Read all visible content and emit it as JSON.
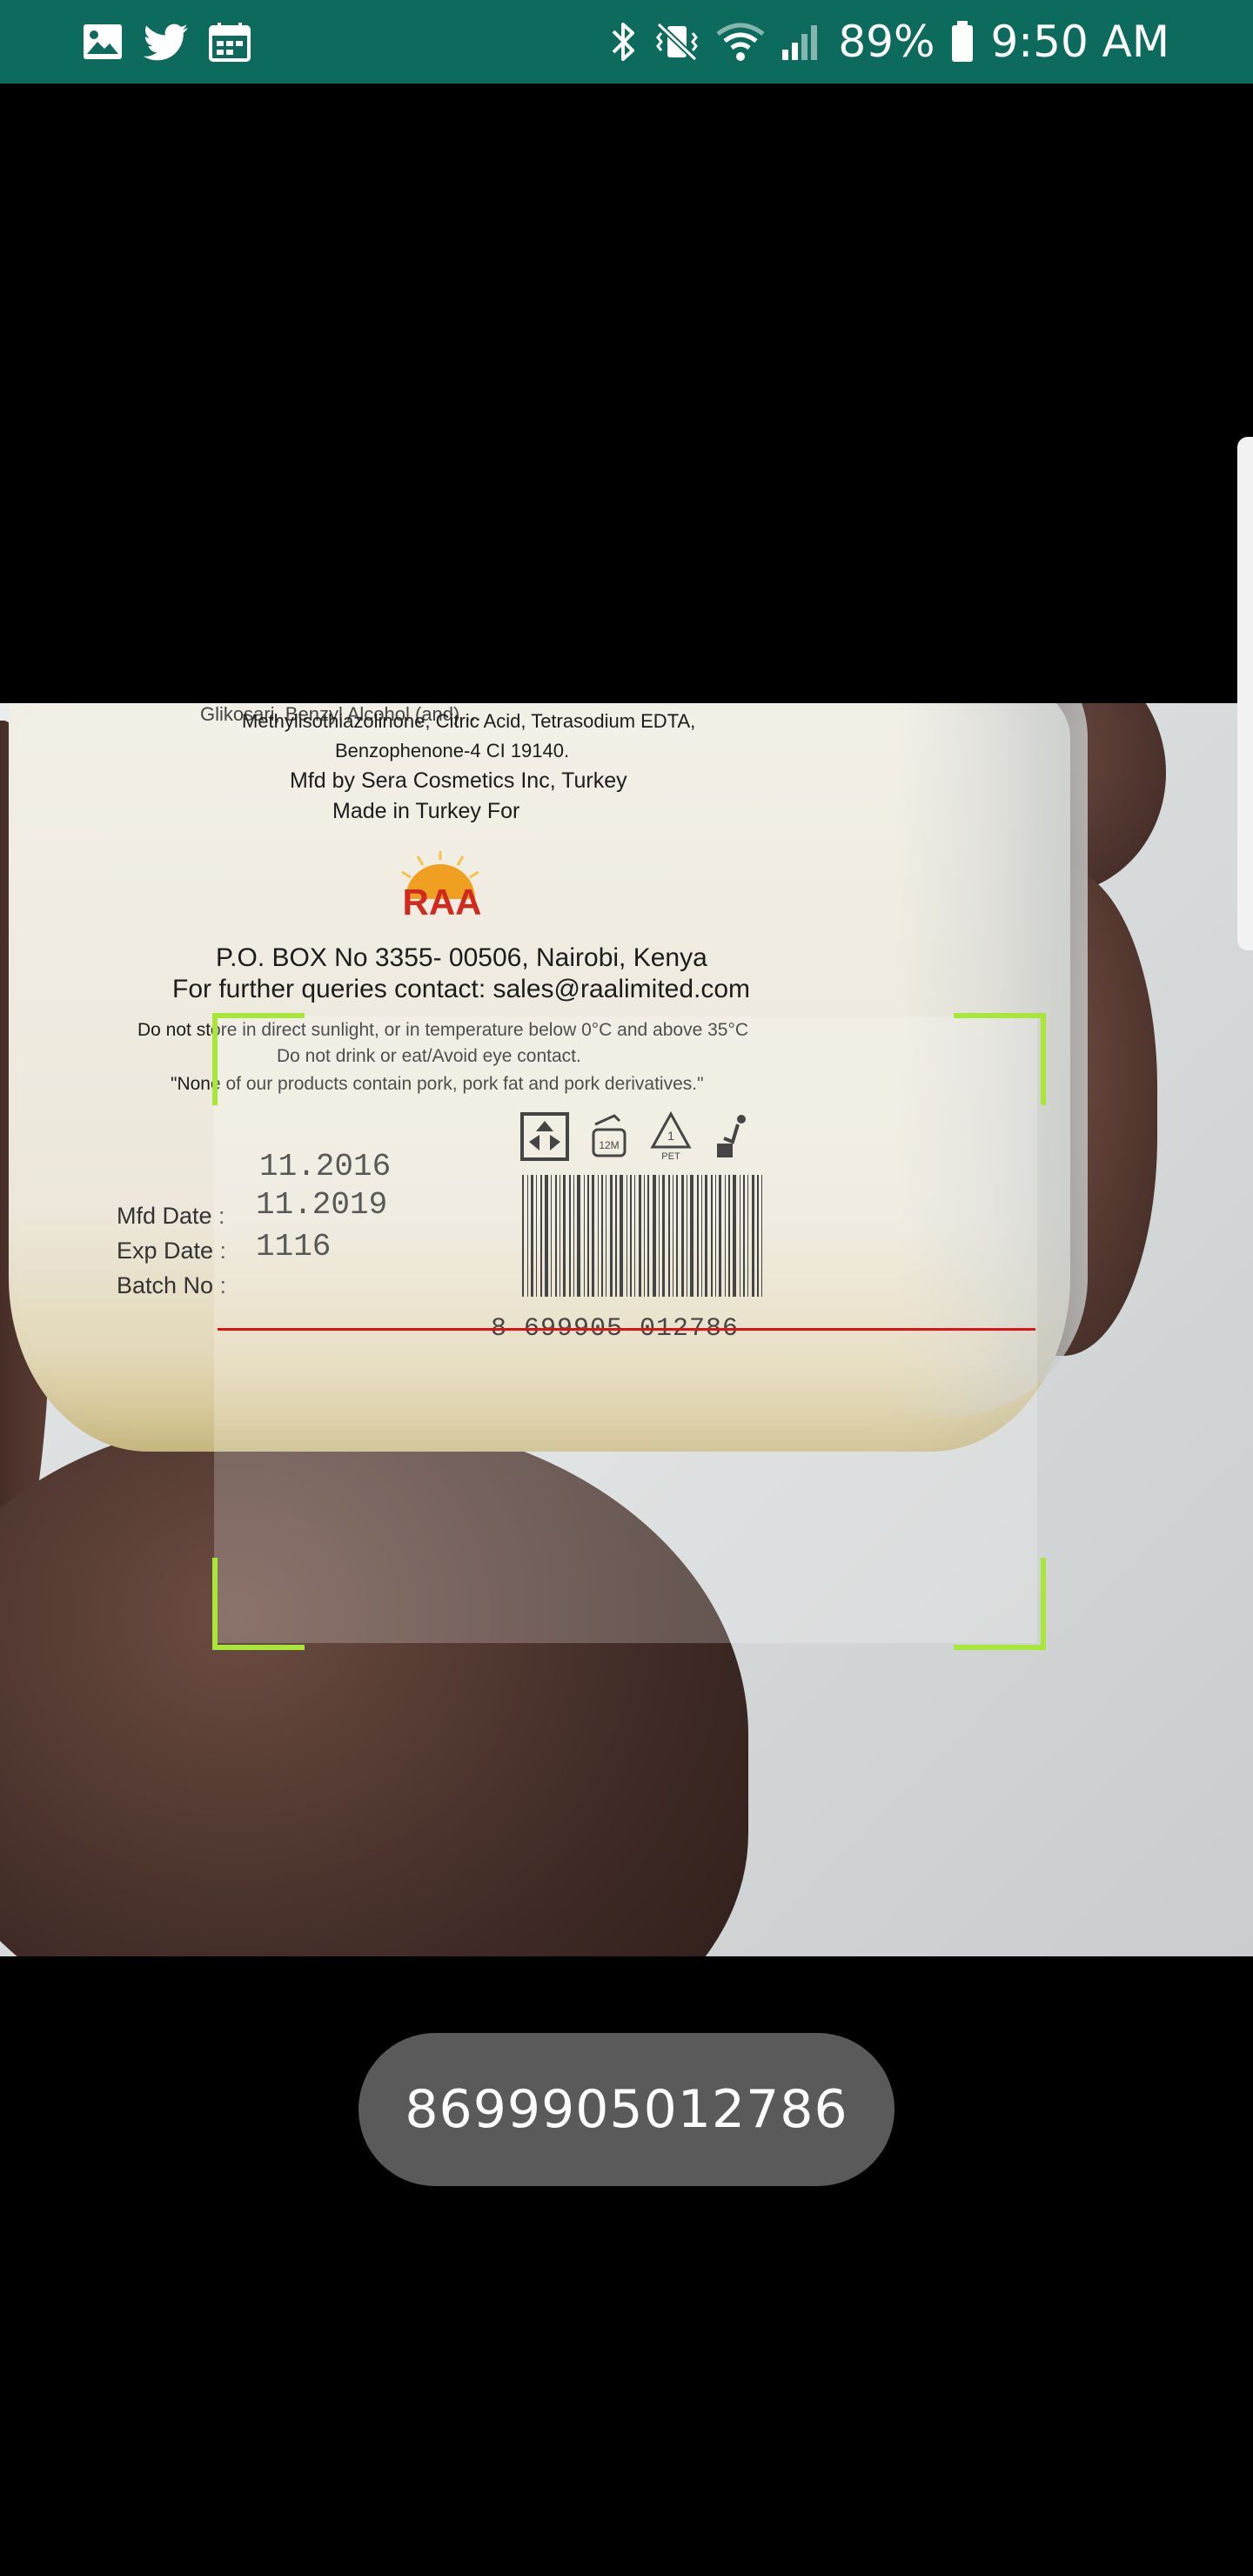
{
  "status_bar": {
    "left_icons": [
      "gallery-icon",
      "twitter-icon",
      "calendar-icon"
    ],
    "right_icons": [
      "bluetooth-icon",
      "vibrate-mute-icon",
      "wifi-icon",
      "signal-icon",
      "battery-icon"
    ],
    "battery_percent": "89%",
    "time": "9:50 AM",
    "background_color": "#0d6b5e"
  },
  "camera_preview": {
    "label_lines": [
      "Glikosari, Benzyl Alcohol (and) ...",
      "Methylisothiazolinone, Citric Acid, Tetrasodium EDTA,",
      "Benzophenone-4  CI 19140.",
      "Mfd by Sera Cosmetics Inc, Turkey",
      "Made in Turkey For"
    ],
    "brand": "RAA",
    "address": "P.O. BOX No 3355- 00506, Nairobi, Kenya",
    "contact": "For further queries contact: sales@raalimited.com",
    "warnings": [
      "Do not store in direct sunlight, or in temperature below 0°C and above 35°C",
      "Do not drink or eat/Avoid eye contact.",
      "\"None of our products contain pork, pork fat and pork derivatives.\""
    ],
    "fields": {
      "mfd_label": "Mfd Date :",
      "exp_label": "Exp Date :",
      "batch_label": "Batch No :",
      "mfd_value": "11.2016",
      "exp_value": "11.2019",
      "batch_value": "1116"
    },
    "recycle_icons": [
      "recycle-box-icon",
      "open-jar-12m-icon",
      "pet-recycle-icon",
      "trash-bin-icon"
    ],
    "recycle_badges": {
      "jar": "12M",
      "pet_number": "1",
      "pet": "PET"
    },
    "barcode_digits": "8 699905 012786"
  },
  "scanner": {
    "frame_color": "#a8e63a",
    "laser_color": "#e01212"
  },
  "result": {
    "barcode_value": "8699905012786"
  }
}
